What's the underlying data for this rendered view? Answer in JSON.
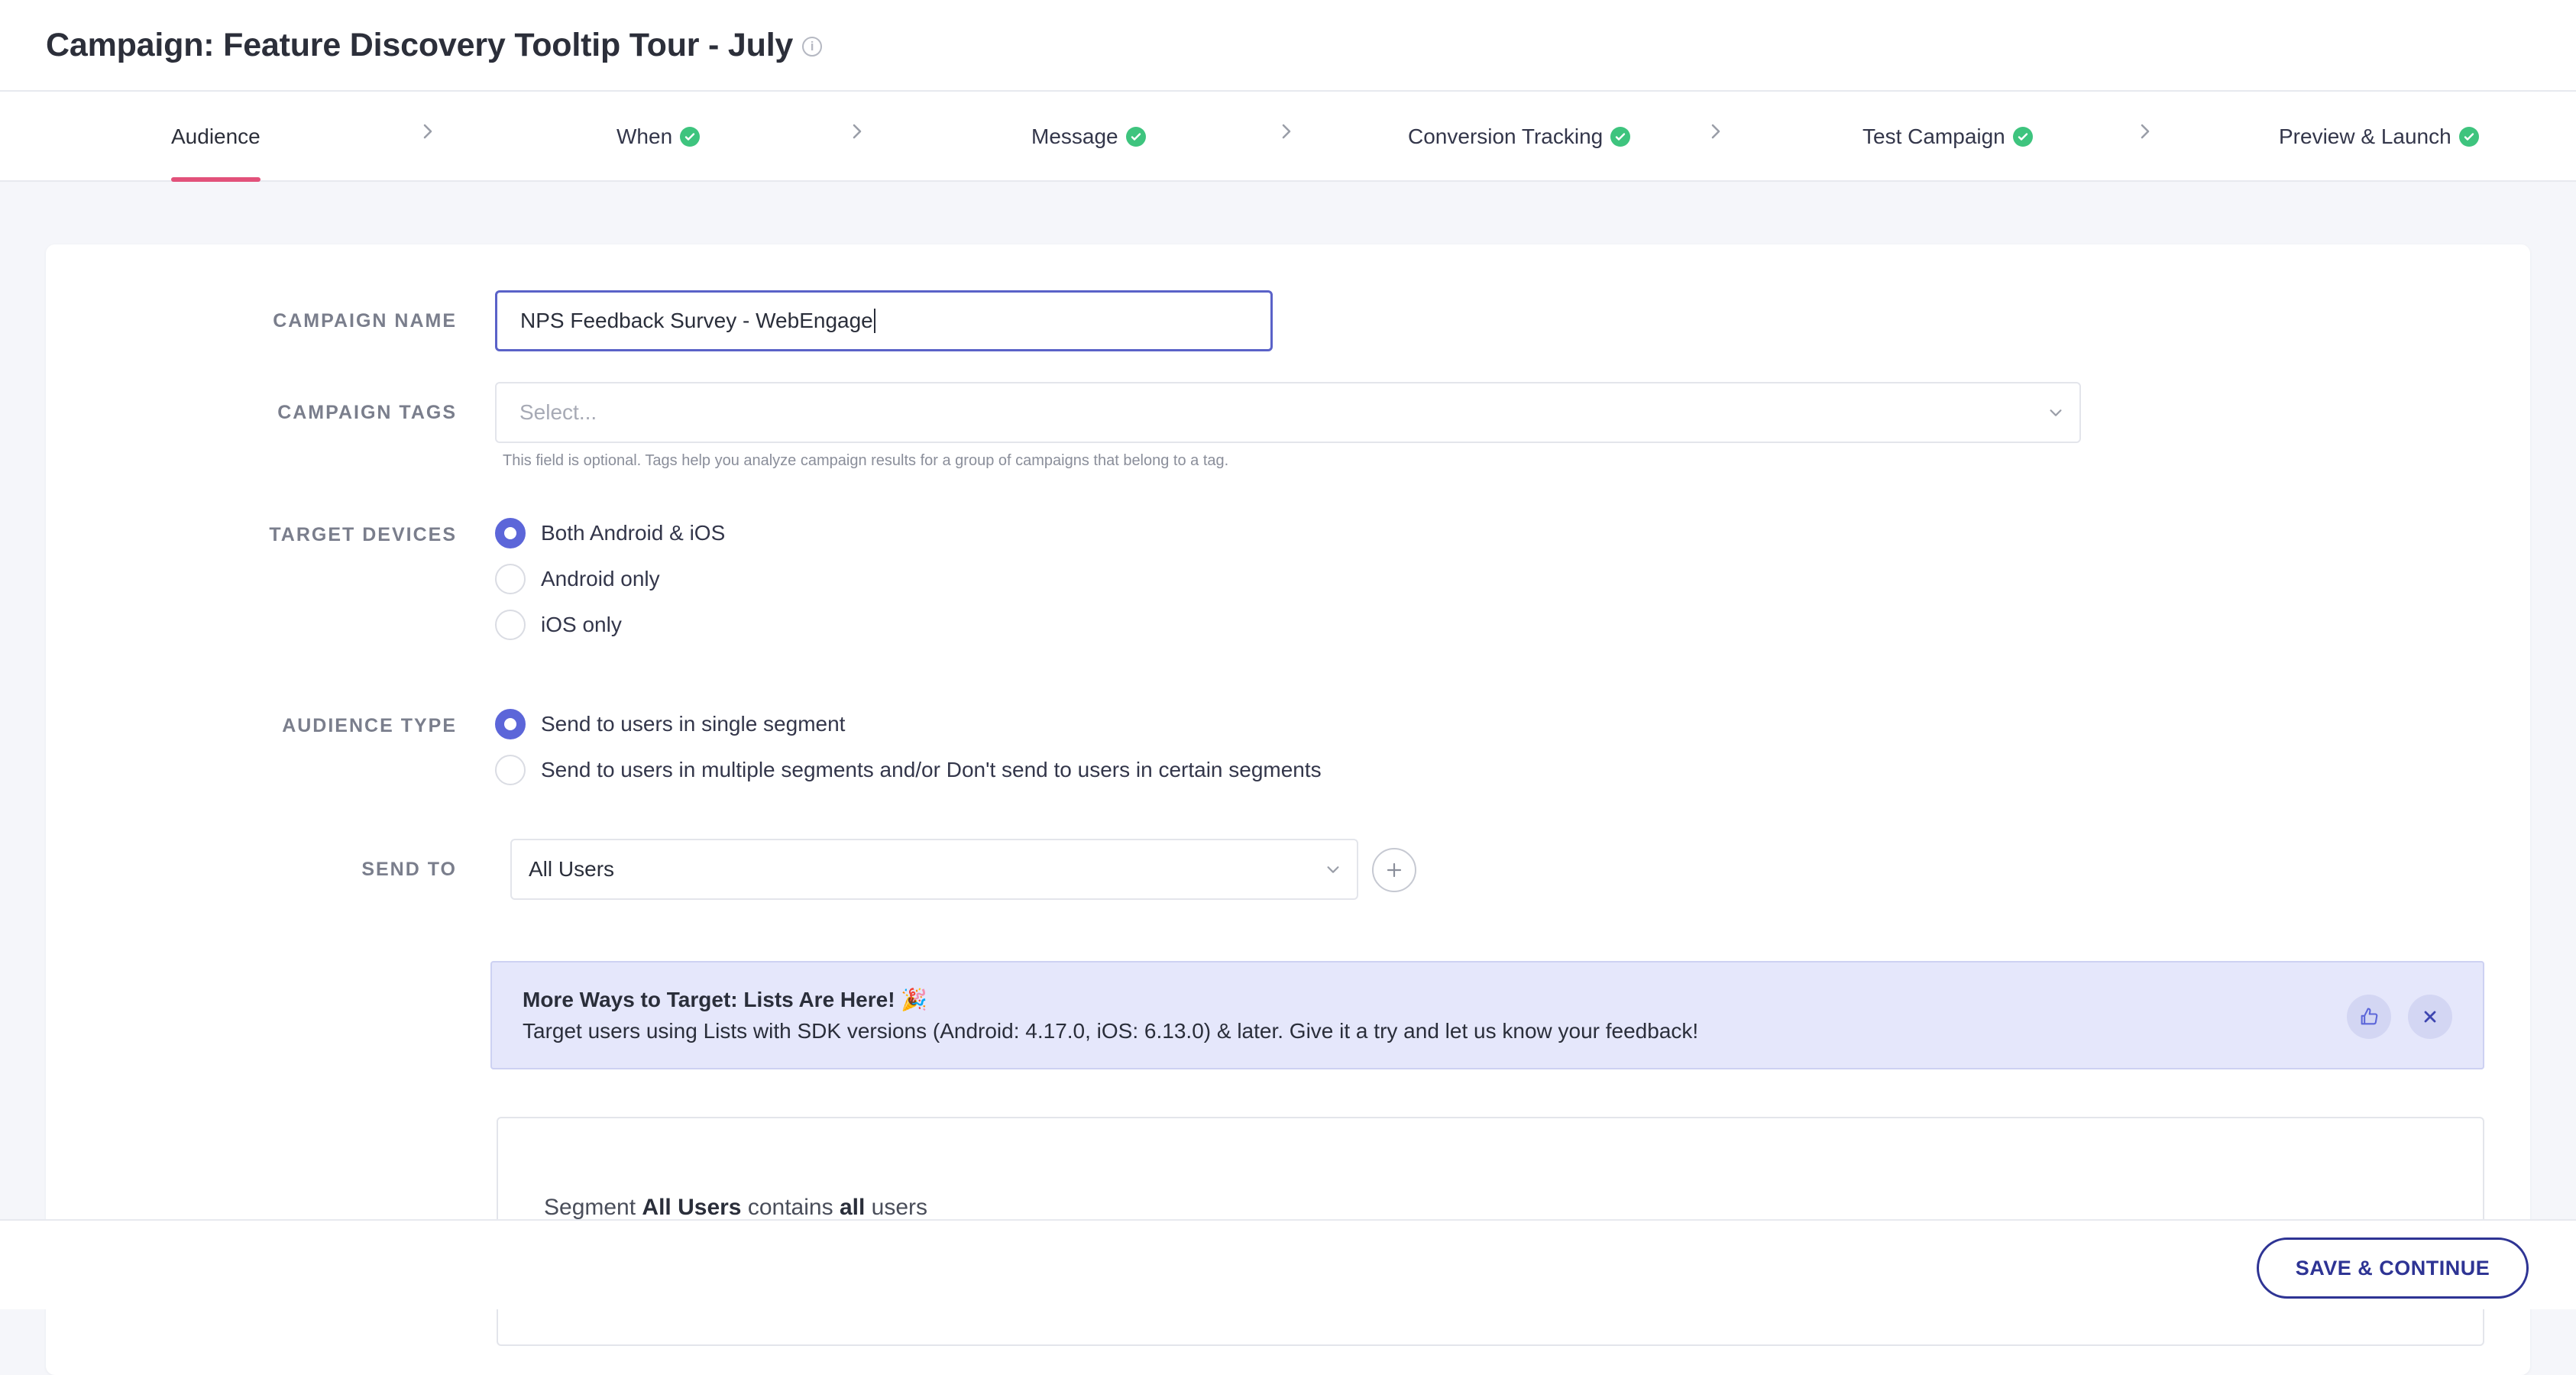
{
  "header": {
    "title": "Campaign: Feature Discovery Tooltip Tour - July",
    "info_icon": "i"
  },
  "stepper": {
    "steps": [
      {
        "label": "Audience",
        "state": "active"
      },
      {
        "label": "When",
        "state": "complete"
      },
      {
        "label": "Message",
        "state": "complete"
      },
      {
        "label": "Conversion Tracking",
        "state": "complete"
      },
      {
        "label": "Test Campaign",
        "state": "complete"
      },
      {
        "label": "Preview & Launch",
        "state": "complete"
      }
    ],
    "colors": {
      "active_underline": "#e2517a",
      "check": "#3ec47e"
    }
  },
  "form": {
    "campaign_name": {
      "label": "CAMPAIGN NAME",
      "value": "NPS Feedback Survey - WebEngage"
    },
    "campaign_tags": {
      "label": "CAMPAIGN TAGS",
      "placeholder": "Select...",
      "helper": "This field is optional. Tags help you analyze campaign results for a group of campaigns that belong to a tag."
    },
    "target_devices": {
      "label": "TARGET DEVICES",
      "options": [
        {
          "label": "Both Android & iOS",
          "selected": true
        },
        {
          "label": "Android only",
          "selected": false
        },
        {
          "label": "iOS only",
          "selected": false
        }
      ]
    },
    "audience_type": {
      "label": "AUDIENCE TYPE",
      "options": [
        {
          "label": "Send to users in single segment",
          "selected": true
        },
        {
          "label": "Send to users in multiple segments and/or Don't send to users in certain segments",
          "selected": false
        }
      ]
    },
    "send_to": {
      "label": "SEND TO",
      "value": "All Users"
    }
  },
  "banner": {
    "title": "More Ways to Target: Lists Are Here! 🎉",
    "text": "Target users using Lists with SDK versions (Android: 4.17.0, iOS: 6.13.0) & later. Give it a try and let us know your feedback!"
  },
  "segment_summary": {
    "prefix": "Segment",
    "segment_name": "All Users",
    "middle": "contains",
    "quantifier": "all",
    "suffix": "users"
  },
  "footer": {
    "save_label": "SAVE & CONTINUE"
  },
  "theme": {
    "accent": "#5c66d9",
    "primary_button": "#2e3494",
    "banner_bg": "#e5e7fb"
  }
}
